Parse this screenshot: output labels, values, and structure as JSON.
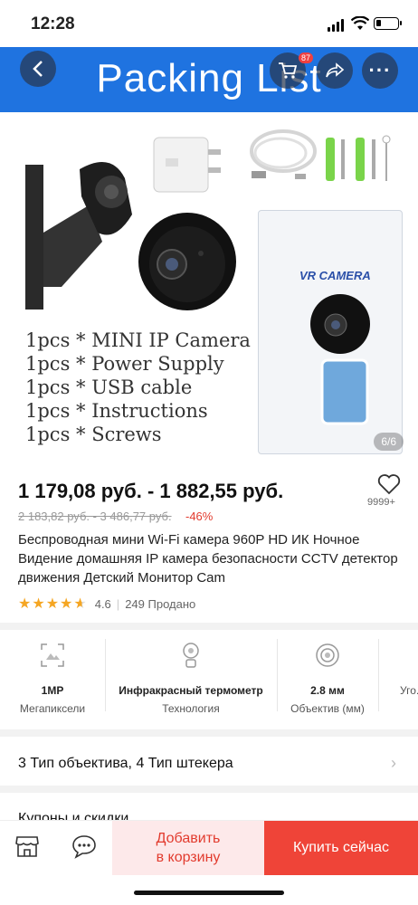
{
  "status_bar": {
    "time": "12:28"
  },
  "hero": {
    "banner_title": "Packing List",
    "cart_badge": "87",
    "more_label": "···",
    "box_label": "VR CAMERA",
    "packing_lines": [
      "1pcs * MINI IP Camera",
      "1pcs * Power Supply",
      "1pcs * USB cable",
      "1pcs * Instructions",
      "1pcs * Screws"
    ],
    "image_counter": "6/6"
  },
  "product": {
    "price_range": "1 179,08 руб. - 1 882,55 руб.",
    "old_price_range": "2 183,82 руб. - 3 486,77 руб.",
    "discount": "-46%",
    "wishlist_count": "9999+",
    "title": "Беспроводная мини Wi-Fi камера 960P HD ИК Ночное Видение домашняя IP камера безопасности CCTV детектор движения Детский Монитор Cam",
    "rating_value": "4.6",
    "rating_stars": 4.6,
    "sold": "249 Продано"
  },
  "specs": [
    {
      "icon": "megapixel-icon",
      "value": "1MP",
      "label": "Мегапиксели"
    },
    {
      "icon": "thermometer-icon",
      "value": "Инфракрасный термометр",
      "label": "Технология"
    },
    {
      "icon": "lens-icon",
      "value": "2.8 мм",
      "label": "Объектив (мм)"
    },
    {
      "icon": "",
      "value": "",
      "label": "Уго."
    }
  ],
  "variant": {
    "label": "3 Тип объектива, 4 Тип штекера"
  },
  "coupons": {
    "label": "Купоны и скидки"
  },
  "bottom_bar": {
    "add_to_cart_line1": "Добавить",
    "add_to_cart_line2": "в корзину",
    "buy_now": "Купить сейчас"
  },
  "colors": {
    "accent": "#ef4438",
    "banner": "#1f73e0",
    "star": "#f5a623"
  }
}
